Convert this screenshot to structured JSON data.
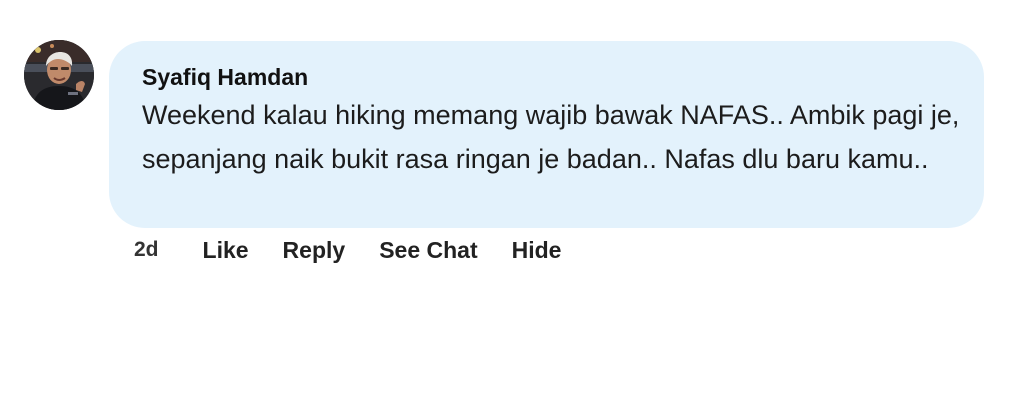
{
  "comment": {
    "author": "Syafiq Hamdan",
    "text": "Weekend kalau hiking memang wajib bawak NAFAS.. Ambik pagi je, sepanjang naik bukit rasa ringan je badan.. Nafas dlu baru kamu..",
    "age": "2d",
    "avatar_icon": "profile-photo",
    "bubble_color": "#e3f2fc"
  },
  "actions": {
    "like": "Like",
    "reply": "Reply",
    "see_chat": "See Chat",
    "hide": "Hide"
  }
}
